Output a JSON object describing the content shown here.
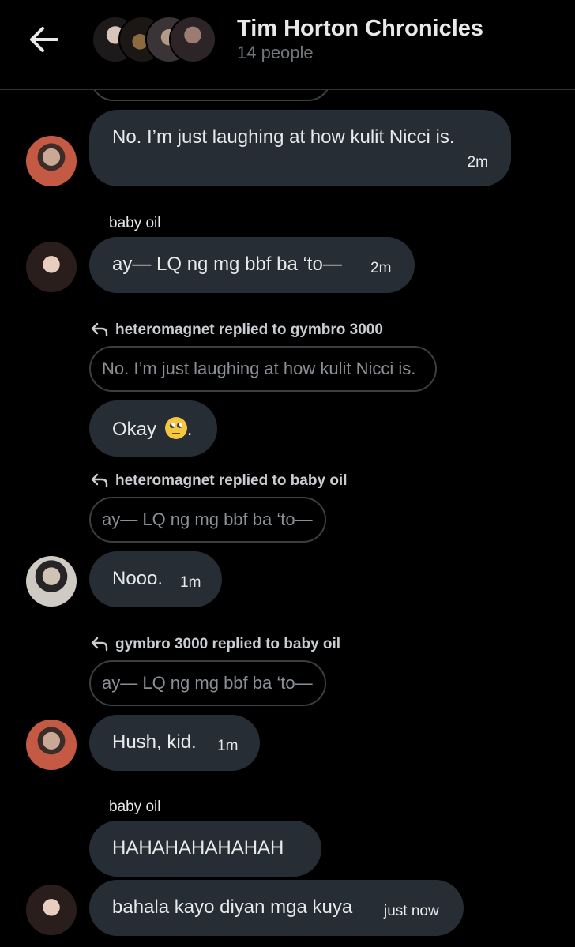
{
  "header": {
    "title": "Tim Horton Chronicles",
    "subtitle": "14 people",
    "back_icon": "arrow-left-icon"
  },
  "messages": [
    {
      "text": "No. I’m just laughing at how kulit Nicci is.",
      "time": "2m"
    },
    {
      "sender": "baby oil",
      "text": "ay— LQ ng mg bbf ba ‘to—",
      "time": "2m"
    },
    {
      "reply_label": "heteromagnet replied to gymbro 3000",
      "quote": "No. I’m just laughing at how kulit Nicci is.",
      "text": "Okay",
      "text_suffix": ".",
      "emoji": "face-with-rolling-eyes-icon"
    },
    {
      "reply_label": "heteromagnet replied to baby oil",
      "quote": "ay— LQ ng mg bbf ba ‘to—",
      "text": "Nooo.",
      "time": "1m"
    },
    {
      "reply_label": "gymbro 3000 replied to baby oil",
      "quote": "ay— LQ ng mg bbf ba ‘to—",
      "text": "Hush, kid.",
      "time": "1m"
    },
    {
      "sender": "baby oil",
      "text": "HAHAHAHAHAHAH"
    },
    {
      "text": "bahala kayo diyan mga kuya",
      "time": "just now"
    }
  ],
  "colors": {
    "background": "#000000",
    "bubble": "#262d34",
    "muted_text": "#71767b",
    "quote_border": "#3a3f44"
  }
}
